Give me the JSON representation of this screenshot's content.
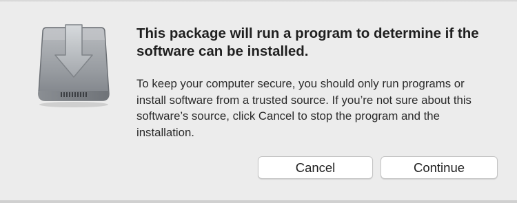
{
  "dialog": {
    "icon": "installer-package-icon",
    "title": "This package will run a program to determine if the software can be installed.",
    "body": "To keep your computer secure, you should only run programs or install software from a trusted source. If you’re not sure about this software’s source, click Cancel to stop the program and the installation.",
    "buttons": {
      "cancel": "Cancel",
      "continue": "Continue"
    }
  }
}
